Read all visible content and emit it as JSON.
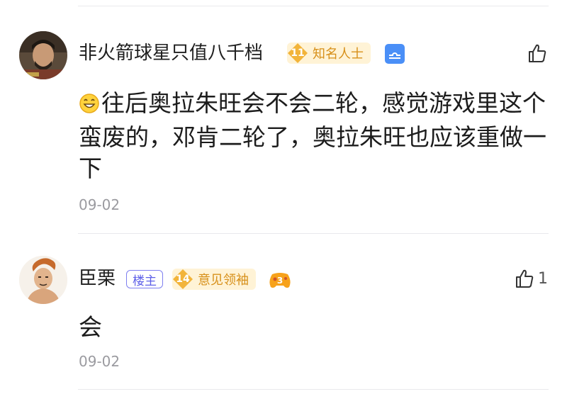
{
  "comments": [
    {
      "username": "非火箭球星只值八千档",
      "level": "11",
      "title_badge": "知名人士",
      "zodiac_icon": "libra-icon",
      "text": "往后奥拉朱旺会不会二轮，感觉游戏里这个蛮废的，邓肯二轮了，奥拉朱旺也应该重做一下",
      "date": "09-02",
      "like_count": ""
    },
    {
      "username": "臣栗",
      "op_badge": "楼主",
      "level": "14",
      "title_badge": "意见领袖",
      "extra_icon": "gamepad-3-icon",
      "text": "会",
      "date": "09-02",
      "like_count": "1"
    }
  ],
  "colors": {
    "accent_gold": "#f0b33c",
    "op_purple": "#6a6cf0",
    "zodiac_blue": "#4a8ff7",
    "muted": "#9b9ba0"
  }
}
